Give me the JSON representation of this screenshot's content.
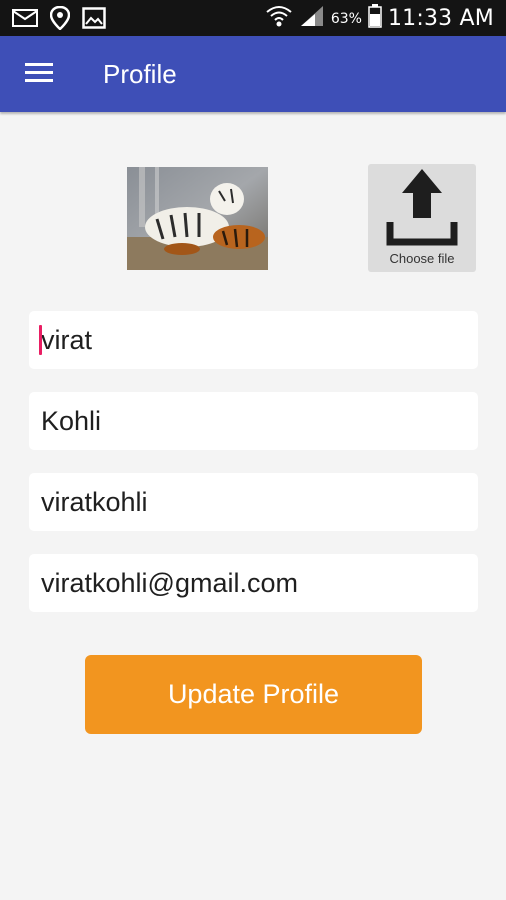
{
  "status_bar": {
    "time": "11:33 AM",
    "battery_percent": "63%",
    "icons": [
      "mail-icon",
      "location-icon",
      "image-icon",
      "wifi-icon",
      "signal-icon",
      "battery-icon"
    ]
  },
  "app_bar": {
    "title": "Profile",
    "menu_icon": "hamburger-menu-icon",
    "color": "#3e4fb7"
  },
  "profile": {
    "photo": "tiger-photo",
    "choose_file_label": "Choose file",
    "upload_icon": "upload-icon"
  },
  "form": {
    "first_name": "virat",
    "last_name": "Kohli",
    "username": "viratkohli",
    "email": "viratkohli@gmail.com"
  },
  "actions": {
    "update_label": "Update Profile",
    "update_color": "#f2951f"
  },
  "colors": {
    "caret": "#e91e63",
    "background": "#f4f4f4"
  }
}
